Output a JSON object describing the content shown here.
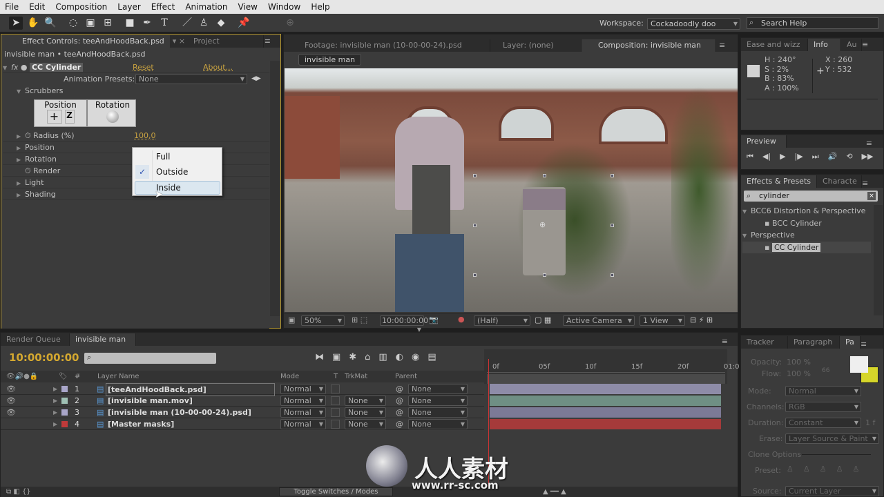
{
  "menu": [
    "File",
    "Edit",
    "Composition",
    "Layer",
    "Effect",
    "Animation",
    "View",
    "Window",
    "Help"
  ],
  "toolbar": {
    "workspace_label": "Workspace:",
    "workspace_value": "Cockadoodly doo",
    "search_placeholder": "Search Help"
  },
  "effect_controls": {
    "tab": "Effect Controls: teeAndHoodBack.psd",
    "tab2": "Project",
    "breadcrumb": "invisible man • teeAndHoodBack.psd",
    "effect_name": "CC Cylinder",
    "reset": "Reset",
    "about": "About...",
    "presets_label": "Animation Presets:",
    "presets_value": "None",
    "scrubbers": "Scrubbers",
    "scrub_position": "Position",
    "scrub_z": "Z",
    "scrub_rotation": "Rotation",
    "props": [
      {
        "label": "Radius (%)",
        "value": "100,0"
      },
      {
        "label": "Position"
      },
      {
        "label": "Rotation"
      },
      {
        "label": "Render"
      },
      {
        "label": "Light"
      },
      {
        "label": "Shading"
      }
    ],
    "render_menu": {
      "options": [
        "Full",
        "Outside",
        "Inside"
      ],
      "checked": "Outside",
      "hovered": "Inside"
    }
  },
  "viewer": {
    "tabs": [
      "Footage: invisible man (10-00-00-24).psd",
      "Layer: (none)",
      "Composition: invisible man"
    ],
    "comp_button": "invisible man",
    "zoom": "50%",
    "timecode": "10:00:00:00",
    "resolution": "(Half)",
    "camera": "Active Camera",
    "views": "1 View"
  },
  "info": {
    "tabs": [
      "Ease and wizz",
      "Info",
      "Au"
    ],
    "h": "H : 240°",
    "s": "S : 2%",
    "b": "B : 83%",
    "a": "A : 100%",
    "x": "X : 260",
    "y": "Y : 532",
    "swatch": "#d3d3d3"
  },
  "preview": {
    "tab": "Preview"
  },
  "effects_presets": {
    "tabs": [
      "Effects & Presets",
      "Characte"
    ],
    "search": "cylinder",
    "groups": [
      {
        "name": "BCC6 Distortion & Perspective",
        "items": [
          "BCC Cylinder"
        ]
      },
      {
        "name": "Perspective",
        "items": [
          "CC Cylinder"
        ]
      }
    ]
  },
  "timeline": {
    "tabs": [
      "Render Queue",
      "invisible man"
    ],
    "timecode": "10:00:00:00",
    "columns": {
      "hash": "#",
      "name": "Layer Name",
      "mode": "Mode",
      "t": "T",
      "trkmat": "TrkMat",
      "parent": "Parent"
    },
    "layers": [
      {
        "num": "1",
        "name": "[teeAndHoodBack.psd]",
        "mode": "Normal",
        "trkmat": "",
        "parent": "None",
        "color": "#a9a6c9",
        "bar": "#8e8ca8"
      },
      {
        "num": "2",
        "name": "[invisible man.mov]",
        "mode": "Normal",
        "trkmat": "None",
        "parent": "None",
        "color": "#9fc0b4",
        "bar": "#6f8f84"
      },
      {
        "num": "3",
        "name": "[invisible man (10-00-00-24).psd]",
        "mode": "Normal",
        "trkmat": "None",
        "parent": "None",
        "color": "#a9a6c9",
        "bar": "#7c7a96"
      },
      {
        "num": "4",
        "name": "[Master masks]",
        "mode": "Normal",
        "trkmat": "None",
        "parent": "None",
        "color": "#c03a3a",
        "bar": "#a53a3a"
      }
    ],
    "ruler": [
      "0f",
      "05f",
      "10f",
      "15f",
      "20f",
      "01:0"
    ],
    "toggle": "Toggle Switches / Modes"
  },
  "paint": {
    "tabs": [
      "Tracker",
      "Paragraph",
      "Pa"
    ],
    "opacity_label": "Opacity:",
    "opacity": "100 %",
    "flow_label": "Flow:",
    "flow": "100 %",
    "brush": "66",
    "mode_label": "Mode:",
    "mode": "Normal",
    "channels_label": "Channels:",
    "channels": "RGB",
    "duration_label": "Duration:",
    "duration": "Constant",
    "duration_f": "1 f",
    "erase_label": "Erase:",
    "erase": "Layer Source & Paint",
    "clone": "Clone Options",
    "preset_label": "Preset:",
    "source_label": "Source:",
    "source": "Current Layer",
    "fg": "#efefef",
    "bg": "#d6d62a"
  },
  "watermark": {
    "text": "人人素材",
    "url": "www.rr-sc.com"
  }
}
